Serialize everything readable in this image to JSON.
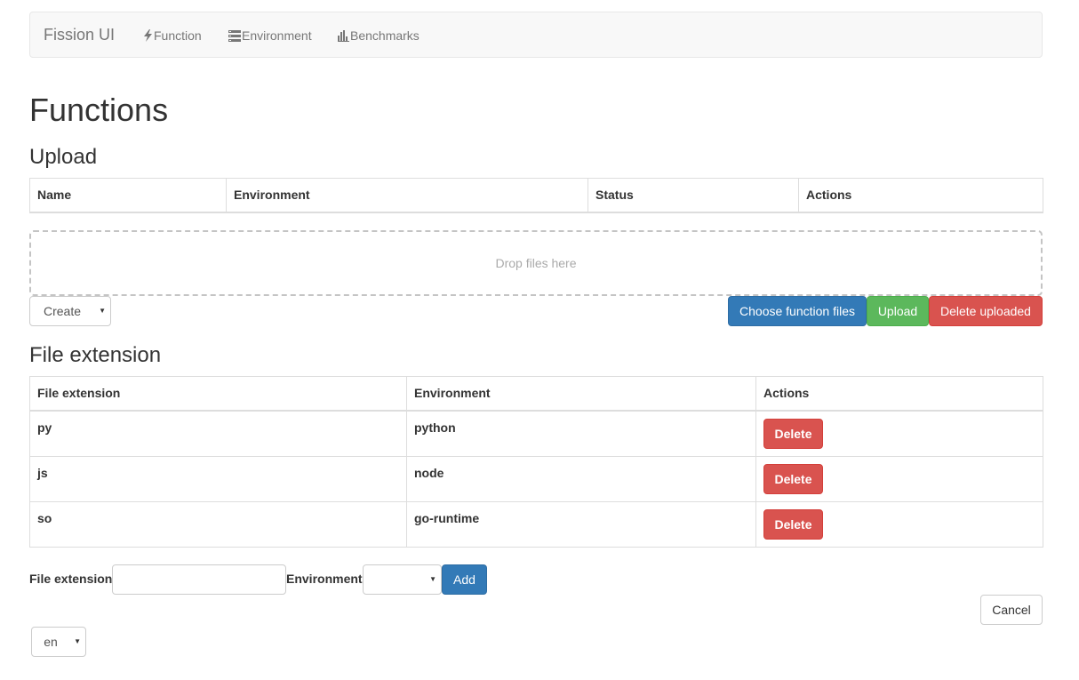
{
  "navbar": {
    "brand": "Fission UI",
    "links": [
      {
        "label": "Function",
        "icon": "bolt-icon"
      },
      {
        "label": "Environment",
        "icon": "list-icon"
      },
      {
        "label": "Benchmarks",
        "icon": "bar-chart-icon"
      }
    ]
  },
  "page": {
    "title": "Functions"
  },
  "upload": {
    "title": "Upload",
    "columns": [
      "Name",
      "Environment",
      "Status",
      "Actions"
    ],
    "dropzone_text": "Drop files here",
    "create_select": "Create",
    "choose_button": "Choose function files",
    "upload_button": "Upload",
    "delete_uploaded_button": "Delete uploaded"
  },
  "file_extension": {
    "title": "File extension",
    "columns": [
      "File extension",
      "Environment",
      "Actions"
    ],
    "rows": [
      {
        "ext": "py",
        "env": "python",
        "action": "Delete"
      },
      {
        "ext": "js",
        "env": "node",
        "action": "Delete"
      },
      {
        "ext": "so",
        "env": "go-runtime",
        "action": "Delete"
      }
    ],
    "form": {
      "ext_label": "File extension",
      "ext_value": "",
      "env_label": "Environment",
      "env_value": "",
      "add_button": "Add"
    }
  },
  "cancel_button": "Cancel",
  "language_select": "en",
  "colors": {
    "primary": "#337ab7",
    "success": "#5cb85c",
    "danger": "#d9534f",
    "navbar_bg": "#f8f8f8"
  }
}
